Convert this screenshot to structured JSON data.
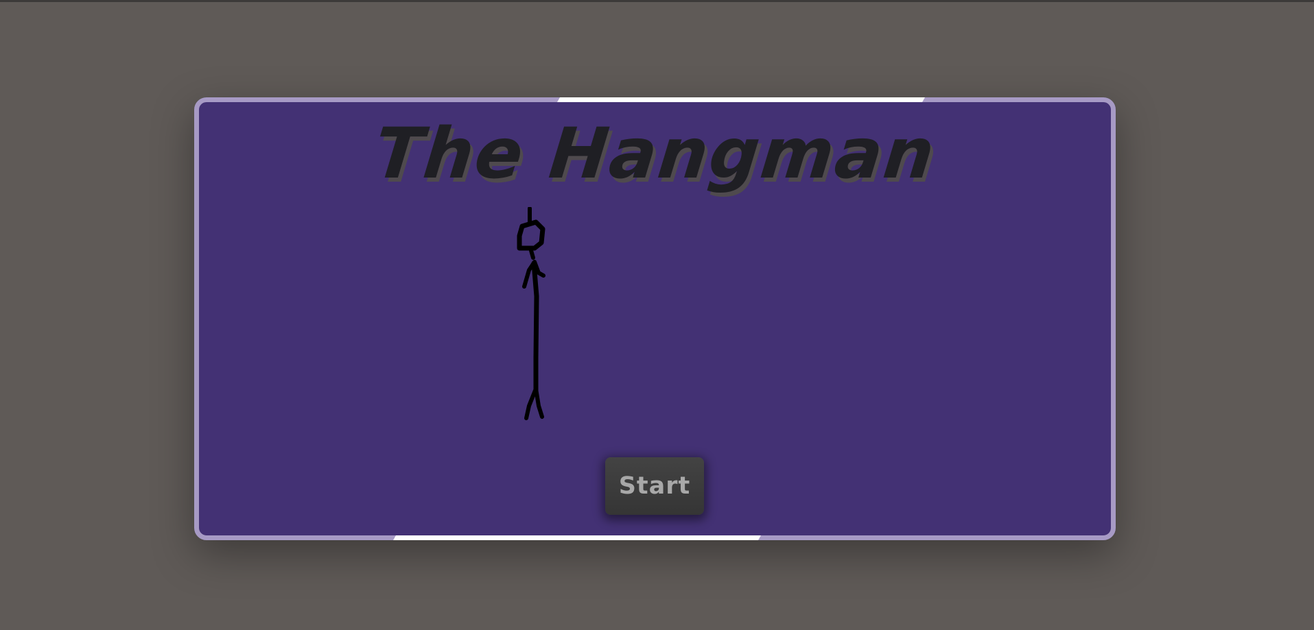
{
  "game": {
    "title": "The Hangman",
    "start_label": "Start"
  },
  "colors": {
    "page_background": "#5f5a57",
    "card_background": "#433174",
    "card_border": "#a79ac5",
    "title_text": "#1f1f24",
    "button_background": "#3c3c3c",
    "button_text": "#a8a8a8"
  },
  "figure": {
    "icon": "stick-figure-hangman",
    "parts_drawn": [
      "rope",
      "head",
      "body",
      "arms",
      "legs"
    ]
  }
}
